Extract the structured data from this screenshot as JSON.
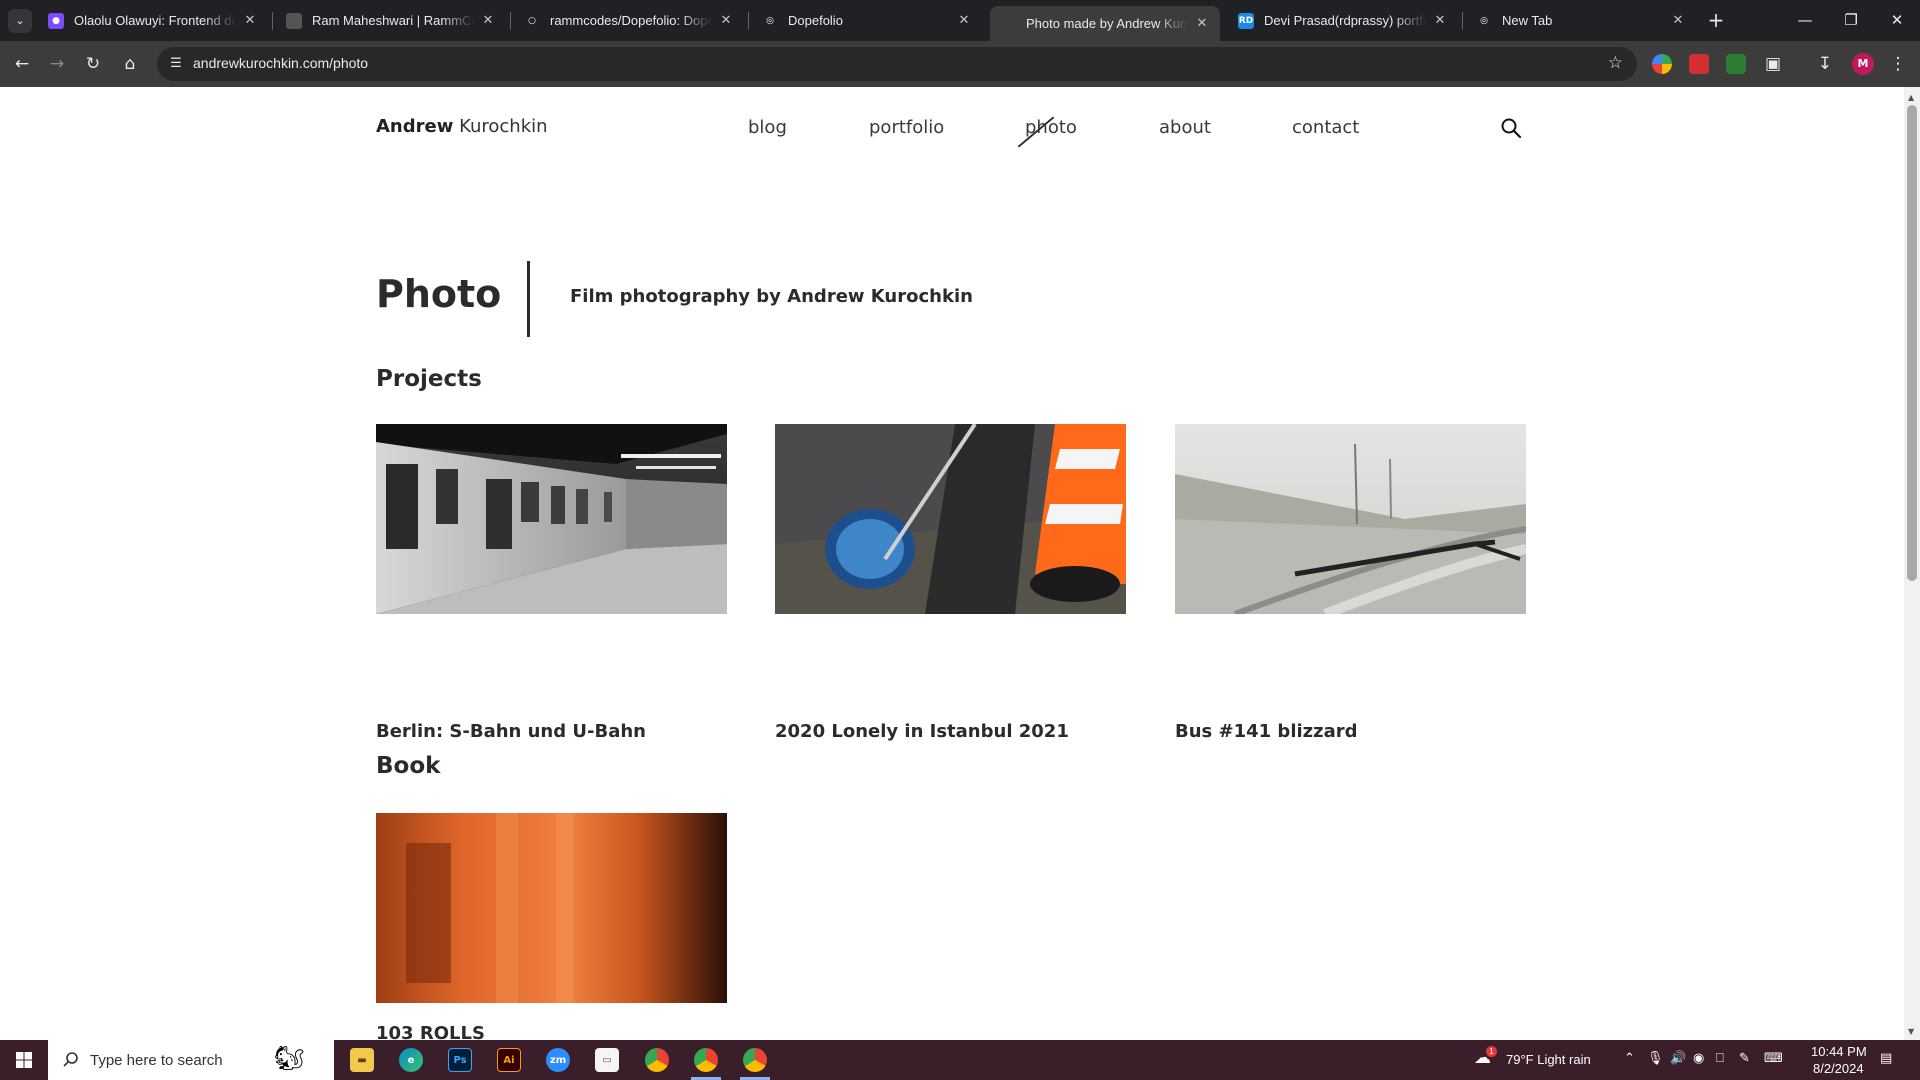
{
  "browser": {
    "tabs": [
      {
        "title": "Olaolu Olawuyi: Frontend deve",
        "fav_color": "#7c4dff",
        "fav_glyph": "●",
        "active": false
      },
      {
        "title": "Ram Maheshwari | RammCode",
        "fav_color": "#555555",
        "fav_glyph": "",
        "active": false
      },
      {
        "title": "rammcodes/Dopefolio: Dopefo",
        "fav_color": "#202124",
        "fav_glyph": "○",
        "active": false
      },
      {
        "title": "Dopefolio",
        "fav_color": "#202124",
        "fav_glyph": "◎",
        "active": false
      },
      {
        "title": "Photo made by Andrew Kuroch",
        "fav_color": "#3c3c3c",
        "fav_glyph": "",
        "active": true
      },
      {
        "title": "Devi Prasad(rdprassy) portfolio",
        "fav_color": "#1e88e5",
        "fav_glyph": "RD",
        "active": false
      },
      {
        "title": "New Tab",
        "fav_color": "#202124",
        "fav_glyph": "◎",
        "active": false
      }
    ],
    "url": "andrewkurochkin.com/photo",
    "profile_initial": "M"
  },
  "site": {
    "logo_first": "Andrew",
    "logo_last": "Kurochkin",
    "nav": [
      "blog",
      "portfolio",
      "photo",
      "about",
      "contact"
    ],
    "active_nav": "photo"
  },
  "page": {
    "heading": "Photo",
    "subtitle": "Film photography by Andrew Kurochkin",
    "projects_title": "Projects",
    "projects": [
      {
        "title": "Berlin: S-Bahn und U-Bahn",
        "image": "subway-train-photo"
      },
      {
        "title": "2020 Lonely in Istanbul 2021",
        "image": "traffic-cone-photo"
      },
      {
        "title": "Bus #141 blizzard",
        "image": "snowy-road-photo"
      }
    ],
    "book_title": "Book",
    "book": [
      {
        "title": "103 ROLLS",
        "image": "orange-film-photo"
      }
    ]
  },
  "taskbar": {
    "search_placeholder": "Type here to search",
    "weather": "79°F  Light rain",
    "time": "10:44 PM",
    "date": "8/2/2024",
    "weather_badge": "1"
  },
  "colors": {
    "chrome_dark": "#202124",
    "toolbar": "#3c3c3c",
    "text": "#2b2b2b",
    "taskbar": "#3a1f2a"
  }
}
